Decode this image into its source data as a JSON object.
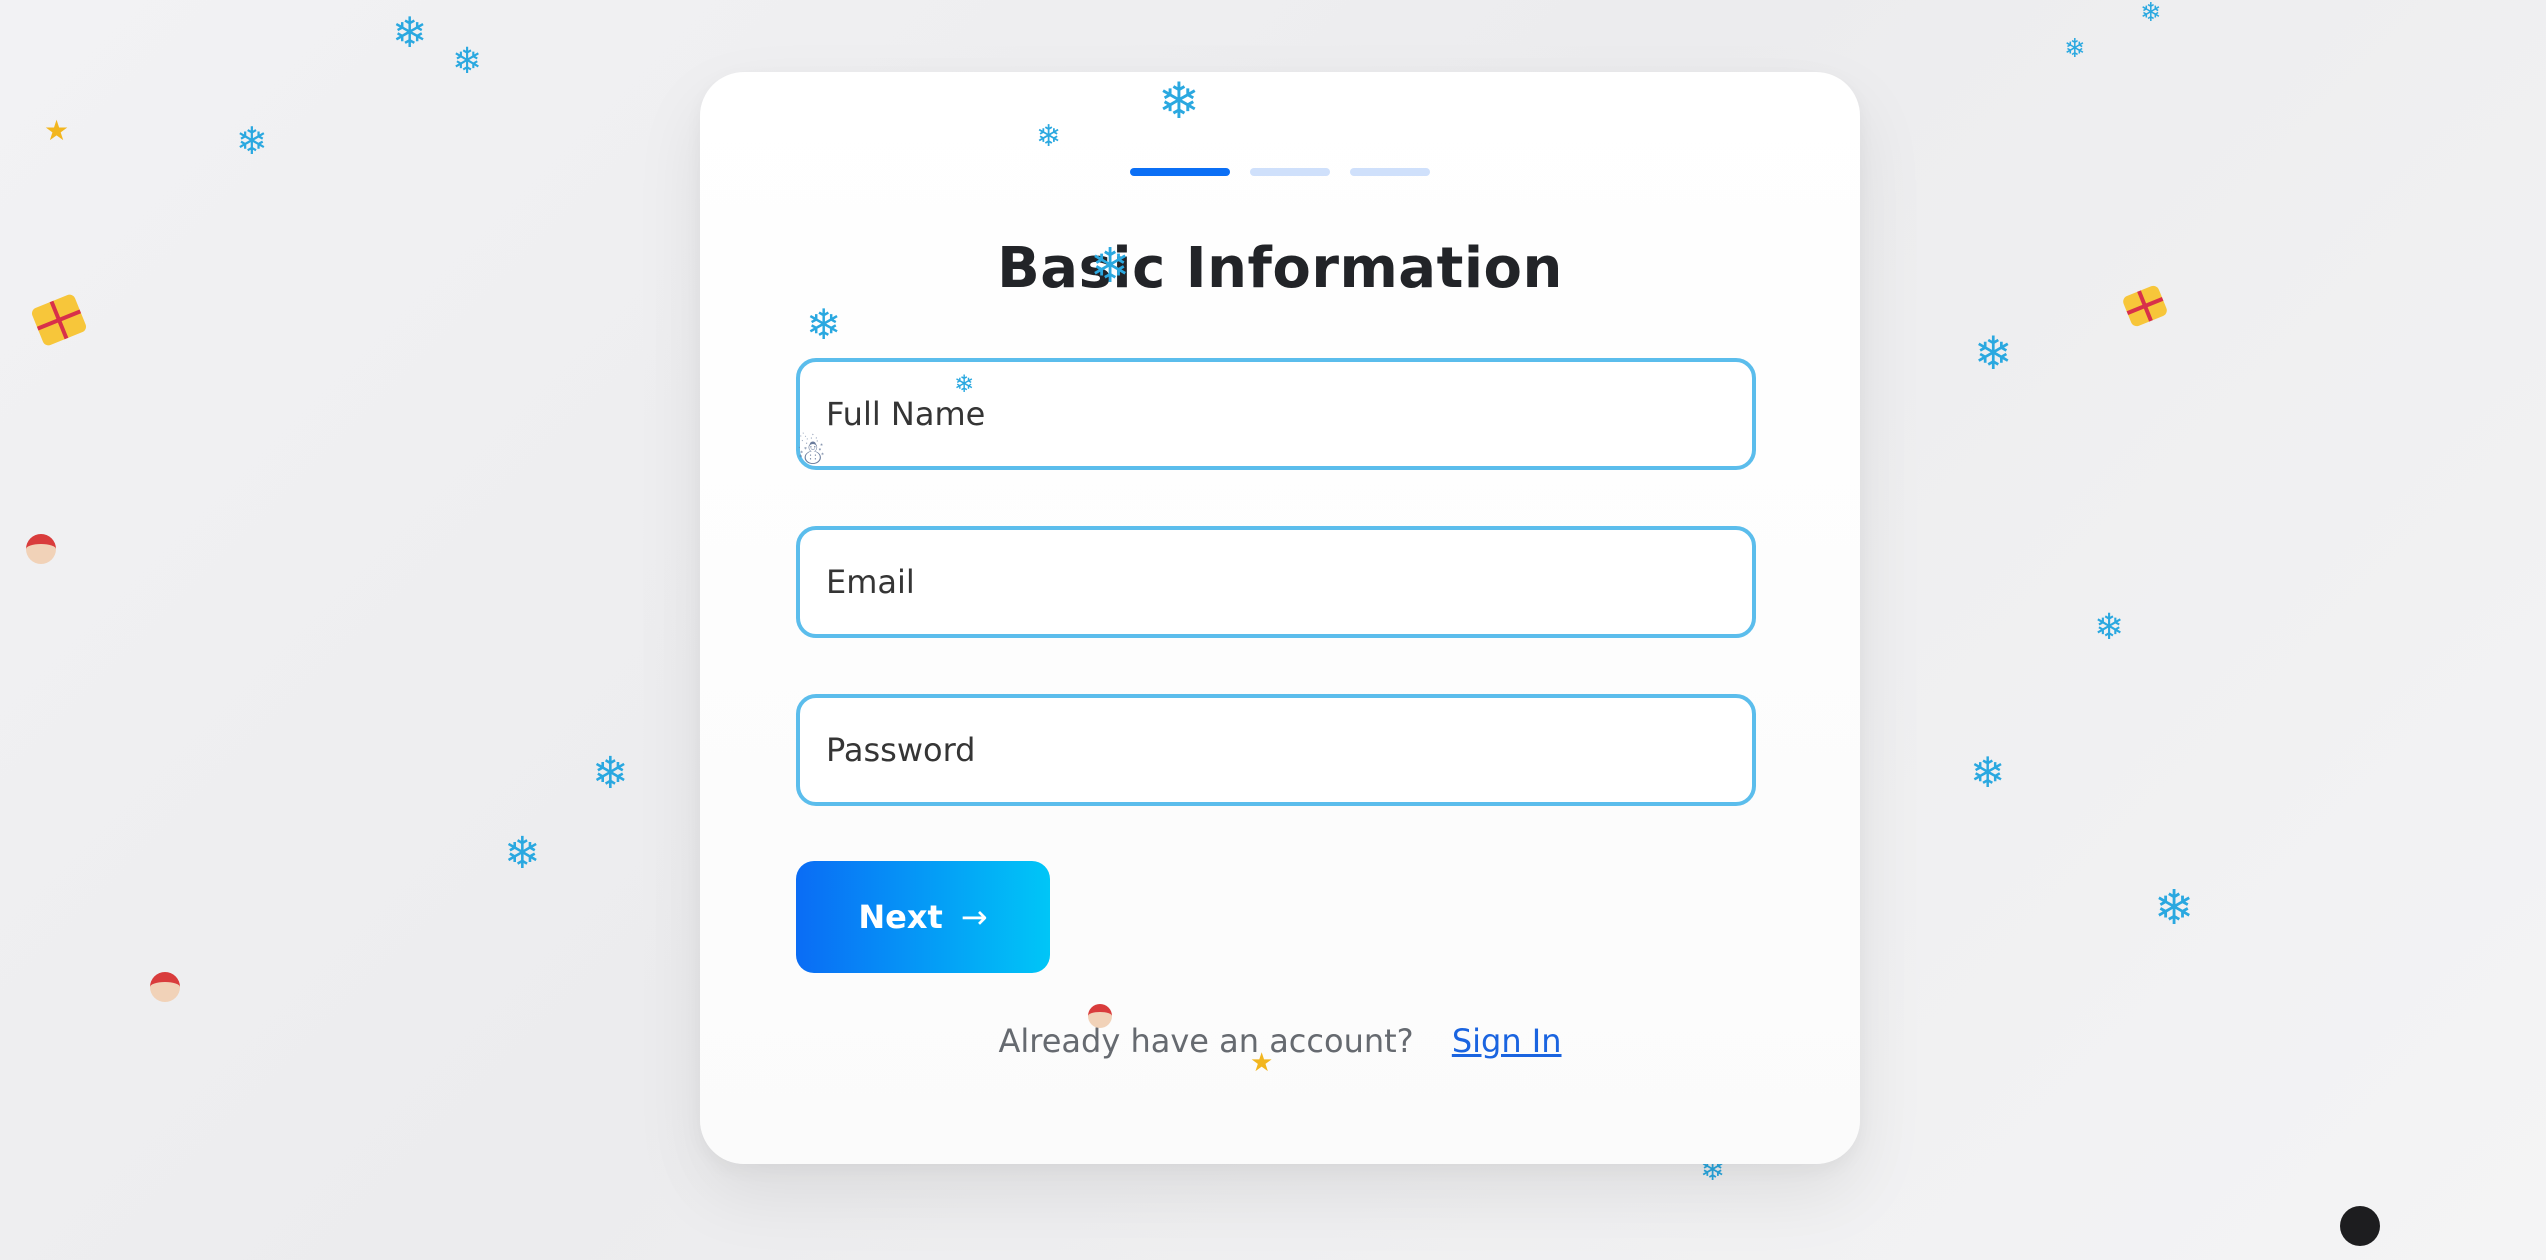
{
  "form": {
    "title": "Basic Information",
    "progress": {
      "current_step": 1,
      "total_steps": 3
    },
    "fields": {
      "full_name": {
        "placeholder": "Full Name",
        "value": ""
      },
      "email": {
        "placeholder": "Email",
        "value": ""
      },
      "password": {
        "placeholder": "Password",
        "value": ""
      }
    },
    "next_button": {
      "label": "Next",
      "icon": "arrow-right-icon"
    },
    "footer": {
      "prompt": "Already have an account?",
      "link": "Sign In"
    }
  },
  "decorations": {
    "snowflake_glyph": "❄",
    "icons": [
      "snowflake-icon",
      "gift-icon",
      "santa-icon",
      "star-icon",
      "snowman-icon"
    ]
  },
  "colors": {
    "accent": "#0b6ff5",
    "field_border": "#5bbdec",
    "button_gradient_start": "#0a6cf5",
    "button_gradient_end": "#00c6f7",
    "link": "#1a64e0",
    "snowflake": "#2aa8e0"
  }
}
